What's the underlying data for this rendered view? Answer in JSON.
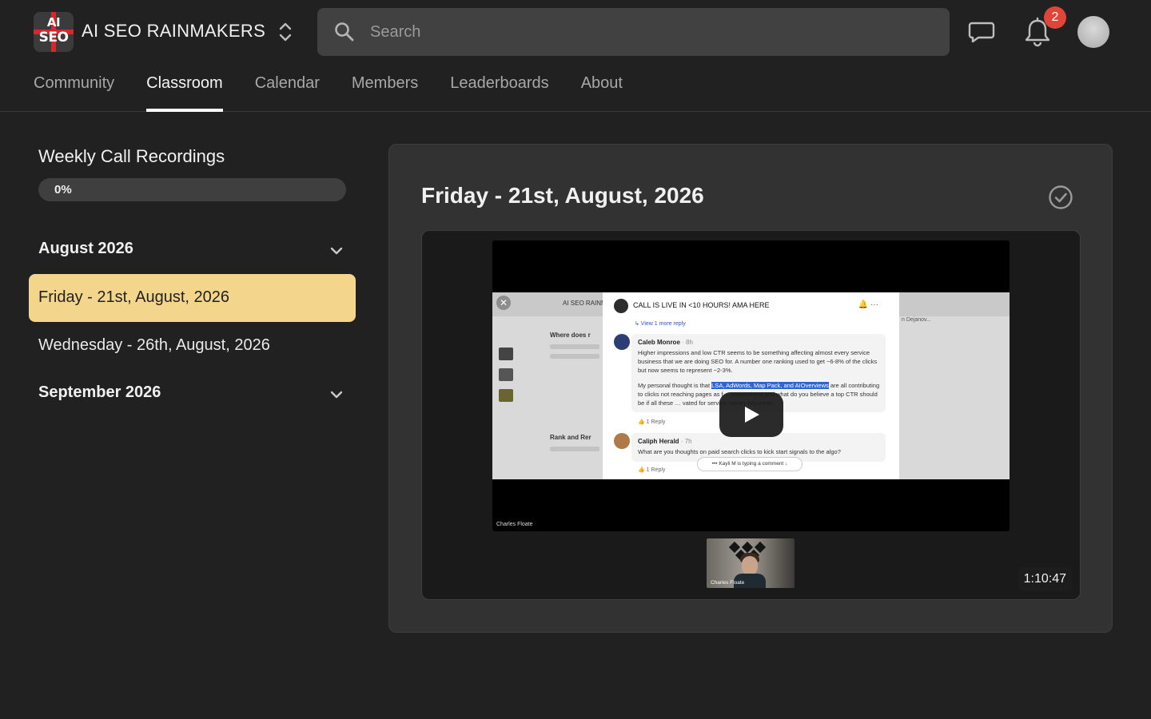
{
  "header": {
    "logo_line1": "AI",
    "logo_line2": "SEO",
    "group_name": "AI SEO RAINMAKERS",
    "search_placeholder": "Search",
    "notification_count": "2"
  },
  "nav": {
    "tabs": [
      {
        "label": "Community",
        "active": false
      },
      {
        "label": "Classroom",
        "active": true
      },
      {
        "label": "Calendar",
        "active": false
      },
      {
        "label": "Members",
        "active": false
      },
      {
        "label": "Leaderboards",
        "active": false
      },
      {
        "label": "About",
        "active": false
      }
    ]
  },
  "sidebar": {
    "course_title": "Weekly Call Recordings",
    "progress_label": "0%",
    "progress_fraction": 0,
    "modules": [
      {
        "label": "August 2026",
        "lessons": [
          "Friday - 21st, August, 2026",
          "Wednesday - 26th, August, 2026"
        ]
      },
      {
        "label": "September 2026",
        "lessons": []
      }
    ]
  },
  "lesson": {
    "title": "Friday - 21st, August, 2026",
    "video_duration": "1:10:47",
    "video_frame": {
      "bg_header_text": "AI SEO RAINN",
      "modal_title": "CALL IS LIVE IN <10 HOURS! AMA HERE",
      "view_more": "↳  View 1 more reply",
      "comment1_name": "Caleb Monroe",
      "comment1_time": "· 8h",
      "comment1_text_a": "Higher impressions and low CTR seems to be something affecting almost every service business that we are doing SEO for. A number one ranking used to get ~6-8% of the clicks but now seems to represent ~2-3%.",
      "comment1_text_b_pre": "My personal thought is that ",
      "comment1_text_b_hl": "LSA, AdWords, Map Pack, and AIOverviews",
      "comment1_text_b_post": " are all contributing to clicks not reaching pages as f… assessment and what do you believe a top CTR should be if all these … vated for service money keywords.",
      "comment1_likes": "👍  1      Reply",
      "comment2_name": "Caliph Herald",
      "comment2_time": "· 7h",
      "comment2_text": "What are you thoughts on paid search clicks to kick start signals to the algo?",
      "comment2_likes": "👍  1      Reply",
      "typing": "•••  Kayli M is typing a comment  ↓",
      "bg_left_1": "Where does r",
      "bg_left_2": "Rank and Rer",
      "bg_right_1": "n Dejanov...",
      "speaker_name": "Charles Floate",
      "camera_name": "Charles Floate"
    }
  },
  "colors": {
    "page_bg": "#212121",
    "panel_bg": "#323232",
    "active_lesson": "#f3d58c",
    "badge": "#e0453a"
  }
}
